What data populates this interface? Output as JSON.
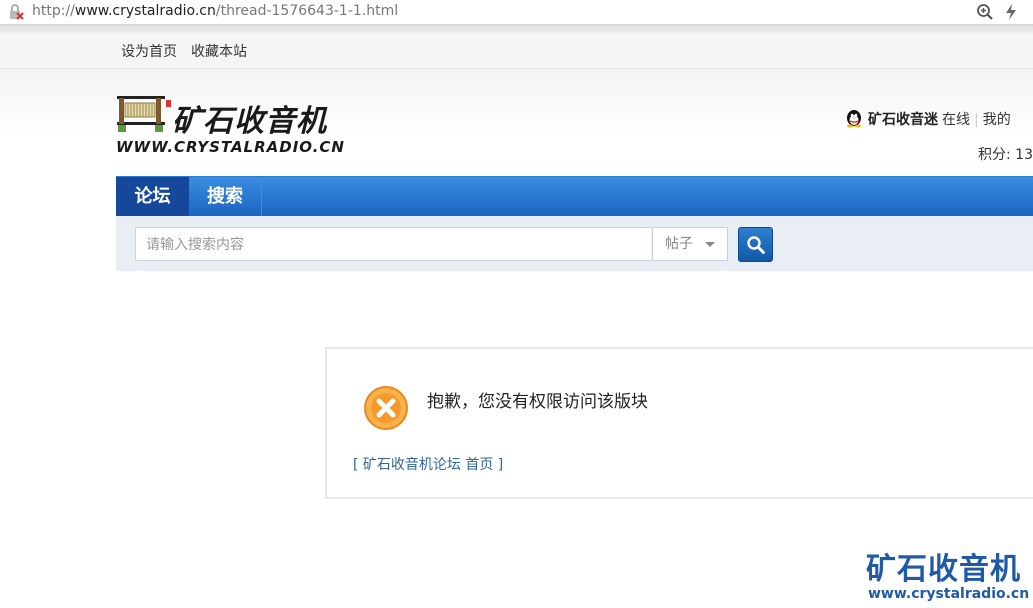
{
  "browser": {
    "url_prefix": "http://",
    "url_host": "www.crystalradio.cn",
    "url_path": "/thread-1576643-1-1.html"
  },
  "topnav": {
    "set_home": "设为首页",
    "bookmark": "收藏本站"
  },
  "logo": {
    "title": "矿石收音机",
    "domain": "WWW.CRYSTALRADIO.CN"
  },
  "user": {
    "name": "矿石收音迷",
    "status": "在线",
    "separator": "|",
    "mine": "我的",
    "points": "积分: 13"
  },
  "navbar": {
    "tabs": [
      {
        "label": "论坛",
        "active": true
      },
      {
        "label": "搜索",
        "active": false
      }
    ]
  },
  "search": {
    "placeholder": "请输入搜索内容",
    "type_selected": "帖子"
  },
  "message": {
    "text": "抱歉，您没有权限访问该版块",
    "back_link": "[ 矿石收音机论坛 首页 ]"
  },
  "watermark": {
    "title": "矿石收音机",
    "domain": "www.crystalradio.cn"
  },
  "colors": {
    "nav_blue": "#1a63c0",
    "nav_active": "#15479a",
    "link": "#336699",
    "error_orange": "#f5a03a",
    "watermark": "#1f5aa8"
  }
}
